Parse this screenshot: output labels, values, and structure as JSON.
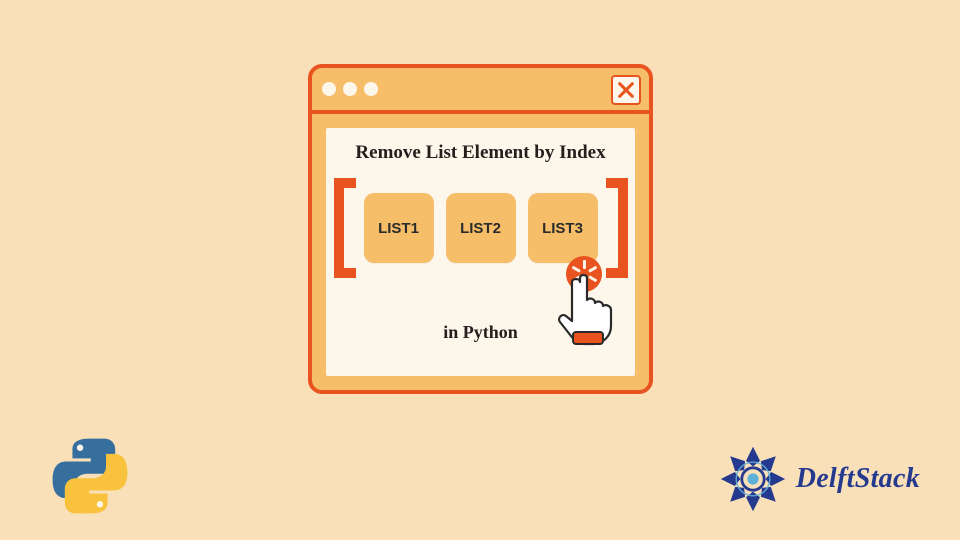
{
  "window": {
    "heading": "Remove List Element by Index",
    "subheading": "in Python",
    "close_label": "X",
    "list_items": [
      "LIST1",
      "LIST2",
      "LIST3"
    ]
  },
  "brand": {
    "name": "DelftStack"
  },
  "icons": {
    "python": "python-logo",
    "brand": "delftstack-logo",
    "close": "close-x",
    "pointer": "hand-pointer"
  },
  "colors": {
    "background": "#f9e0b8",
    "accent": "#e8531f",
    "panel": "#f7be6a",
    "content": "#fdf6ea",
    "brand_text": "#253a8f"
  }
}
